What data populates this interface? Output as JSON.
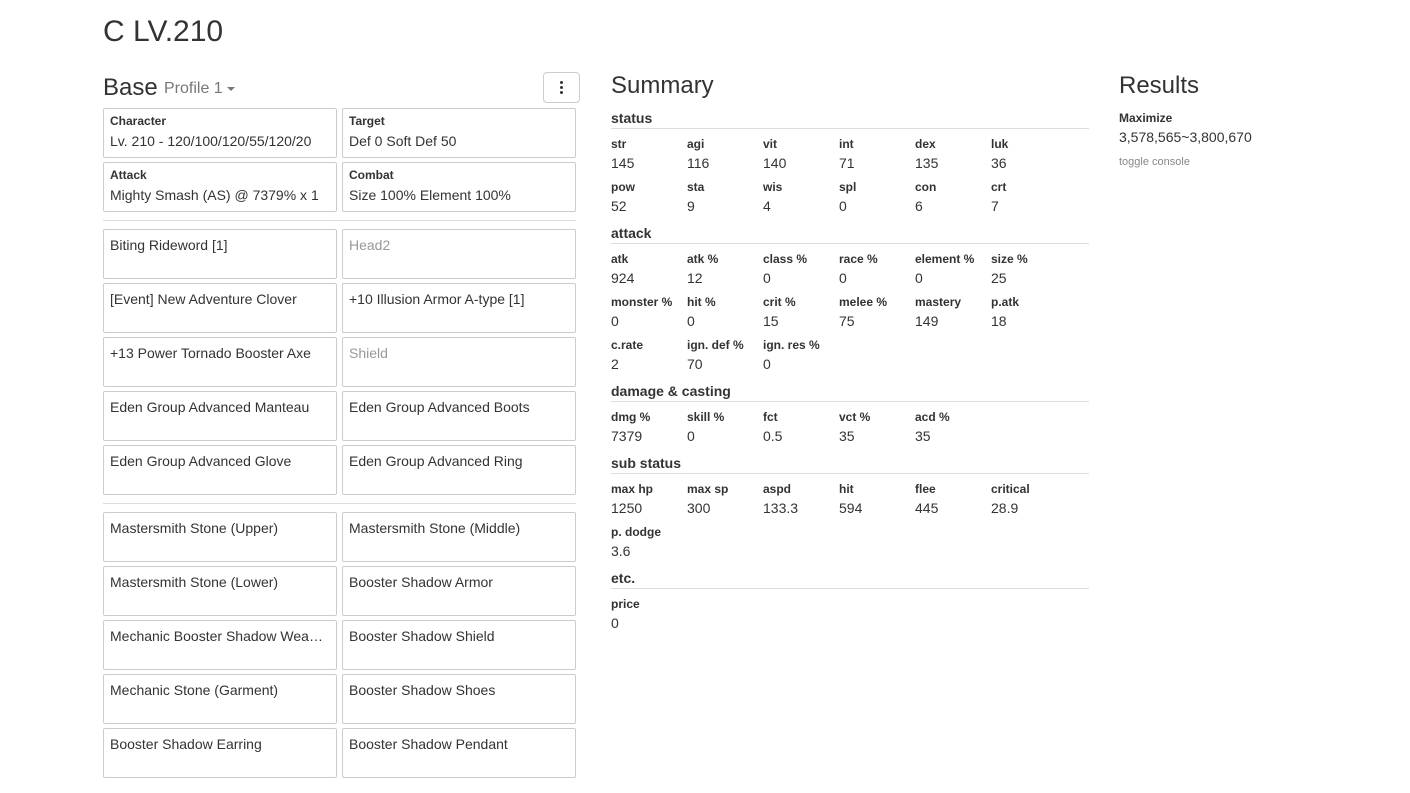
{
  "page_title": "C LV.210",
  "base": {
    "title": "Base",
    "profile": "Profile 1",
    "setup": [
      {
        "label": "Character",
        "value": "Lv. 210 - 120/100/120/55/120/20"
      },
      {
        "label": "Target",
        "value": "Def 0 Soft Def 50"
      },
      {
        "label": "Attack",
        "value": "Mighty Smash (AS) @ 7379% x 1"
      },
      {
        "label": "Combat",
        "value": "Size 100% Element 100%"
      }
    ],
    "equipment": [
      {
        "name": "Biting Rideword [1]",
        "empty": false
      },
      {
        "name": "Head2",
        "empty": true
      },
      {
        "name": "[Event] New Adventure Clover",
        "empty": false
      },
      {
        "name": "+10 Illusion Armor A-type [1]",
        "empty": false
      },
      {
        "name": "+13 Power Tornado Booster Axe",
        "empty": false
      },
      {
        "name": "Shield",
        "empty": true
      },
      {
        "name": "Eden Group Advanced Manteau",
        "empty": false
      },
      {
        "name": "Eden Group Advanced Boots",
        "empty": false
      },
      {
        "name": "Eden Group Advanced Glove",
        "empty": false
      },
      {
        "name": "Eden Group Advanced Ring",
        "empty": false
      }
    ],
    "shadow": [
      {
        "name": "Mastersmith Stone (Upper)",
        "empty": false
      },
      {
        "name": "Mastersmith Stone (Middle)",
        "empty": false
      },
      {
        "name": "Mastersmith Stone (Lower)",
        "empty": false
      },
      {
        "name": "Booster Shadow Armor",
        "empty": false
      },
      {
        "name": "Mechanic Booster Shadow Weapon",
        "empty": false
      },
      {
        "name": "Booster Shadow Shield",
        "empty": false
      },
      {
        "name": "Mechanic Stone (Garment)",
        "empty": false
      },
      {
        "name": "Booster Shadow Shoes",
        "empty": false
      },
      {
        "name": "Booster Shadow Earring",
        "empty": false
      },
      {
        "name": "Booster Shadow Pendant",
        "empty": false
      }
    ]
  },
  "summary": {
    "title": "Summary",
    "sections": [
      {
        "title": "status",
        "stats": [
          {
            "k": "str",
            "v": "145"
          },
          {
            "k": "agi",
            "v": "116"
          },
          {
            "k": "vit",
            "v": "140"
          },
          {
            "k": "int",
            "v": "71"
          },
          {
            "k": "dex",
            "v": "135"
          },
          {
            "k": "luk",
            "v": "36"
          },
          {
            "k": "pow",
            "v": "52"
          },
          {
            "k": "sta",
            "v": "9"
          },
          {
            "k": "wis",
            "v": "4"
          },
          {
            "k": "spl",
            "v": "0"
          },
          {
            "k": "con",
            "v": "6"
          },
          {
            "k": "crt",
            "v": "7"
          }
        ]
      },
      {
        "title": "attack",
        "stats": [
          {
            "k": "atk",
            "v": "924"
          },
          {
            "k": "atk %",
            "v": "12"
          },
          {
            "k": "class %",
            "v": "0"
          },
          {
            "k": "race %",
            "v": "0"
          },
          {
            "k": "element %",
            "v": "0"
          },
          {
            "k": "size %",
            "v": "25"
          },
          {
            "k": "monster %",
            "v": "0"
          },
          {
            "k": "hit %",
            "v": "0"
          },
          {
            "k": "crit %",
            "v": "15"
          },
          {
            "k": "melee %",
            "v": "75"
          },
          {
            "k": "mastery",
            "v": "149"
          },
          {
            "k": "p.atk",
            "v": "18"
          },
          {
            "k": "c.rate",
            "v": "2"
          },
          {
            "k": "ign. def %",
            "v": "70"
          },
          {
            "k": "ign. res %",
            "v": "0"
          }
        ]
      },
      {
        "title": "damage & casting",
        "stats": [
          {
            "k": "dmg %",
            "v": "7379"
          },
          {
            "k": "skill %",
            "v": "0"
          },
          {
            "k": "fct",
            "v": "0.5"
          },
          {
            "k": "vct %",
            "v": "35"
          },
          {
            "k": "acd %",
            "v": "35"
          }
        ]
      },
      {
        "title": "sub status",
        "stats": [
          {
            "k": "max hp",
            "v": "1250"
          },
          {
            "k": "max sp",
            "v": "300"
          },
          {
            "k": "aspd",
            "v": "133.3"
          },
          {
            "k": "hit",
            "v": "594"
          },
          {
            "k": "flee",
            "v": "445"
          },
          {
            "k": "critical",
            "v": "28.9"
          },
          {
            "k": "p. dodge",
            "v": "3.6"
          }
        ]
      },
      {
        "title": "etc.",
        "stats": [
          {
            "k": "price",
            "v": "0"
          }
        ]
      }
    ]
  },
  "results": {
    "title": "Results",
    "label": "Maximize",
    "value": "3,578,565~3,800,670",
    "toggle": "toggle console"
  }
}
